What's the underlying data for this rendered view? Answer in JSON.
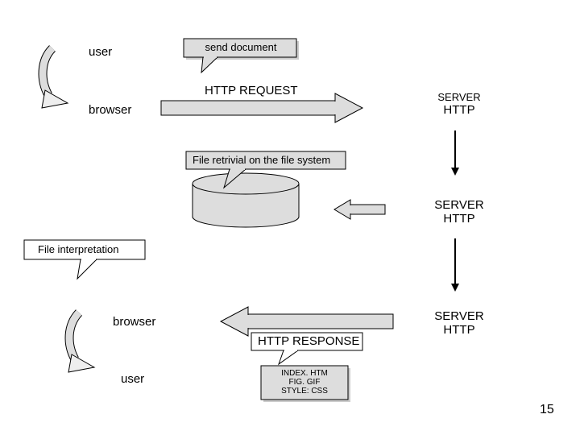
{
  "labels": {
    "user_top": "user",
    "browser_top": "browser",
    "send_document": "send document",
    "http_request": "HTTP REQUEST",
    "server_http_1a": "SERVER",
    "server_http_1b": "HTTP",
    "file_retrieval": "File retrivial on the file system",
    "server_http_2a": "SERVER",
    "server_http_2b": "HTTP",
    "file_interpretation": "File interpretation",
    "browser_bottom": "browser",
    "http_response": "HTTP RESPONSE",
    "server_http_3a": "SERVER",
    "server_http_3b": "HTTP",
    "user_bottom": "user",
    "files_l1": "INDEX. HTM",
    "files_l2": "FIG. GIF",
    "files_l3": "STYLE: CSS"
  },
  "page_number": "15"
}
